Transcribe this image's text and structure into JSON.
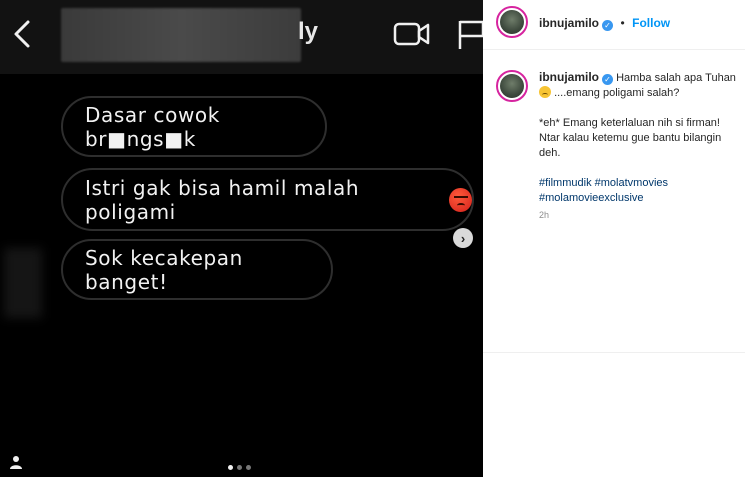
{
  "dm": {
    "name_suffix": "ly",
    "messages": [
      "Dasar cowok br■ngs■k",
      "Istri gak bisa hamil malah poligami",
      "Sok kecakepan banget!"
    ],
    "carousel_dots": 3,
    "active_dot": 0
  },
  "post": {
    "username": "ibnujamilo",
    "separator": "•",
    "follow_label": "Follow",
    "caption": {
      "line1": "Hamba salah apa Tuhan",
      "line1b": "....emang poligami salah?",
      "para2": "*eh* Emang keterlaluan nih si firman! Ntar kalau ketemu gue bantu bilangin deh.",
      "tags": [
        "#filmmudik",
        "#molatvmovies",
        "#molamovieexclusive"
      ]
    },
    "time": "2h"
  },
  "colors": {
    "accent": "#0095f6",
    "verified": "#3897f0",
    "avatar_ring": "#d6249f",
    "hashtag": "#00376b"
  },
  "icons": [
    "back-chevron-icon",
    "video-camera-icon",
    "flag-icon",
    "next-arrow-icon",
    "user-tag-icon",
    "verified-badge-icon",
    "angry-face-emoji",
    "sad-face-emoji"
  ]
}
